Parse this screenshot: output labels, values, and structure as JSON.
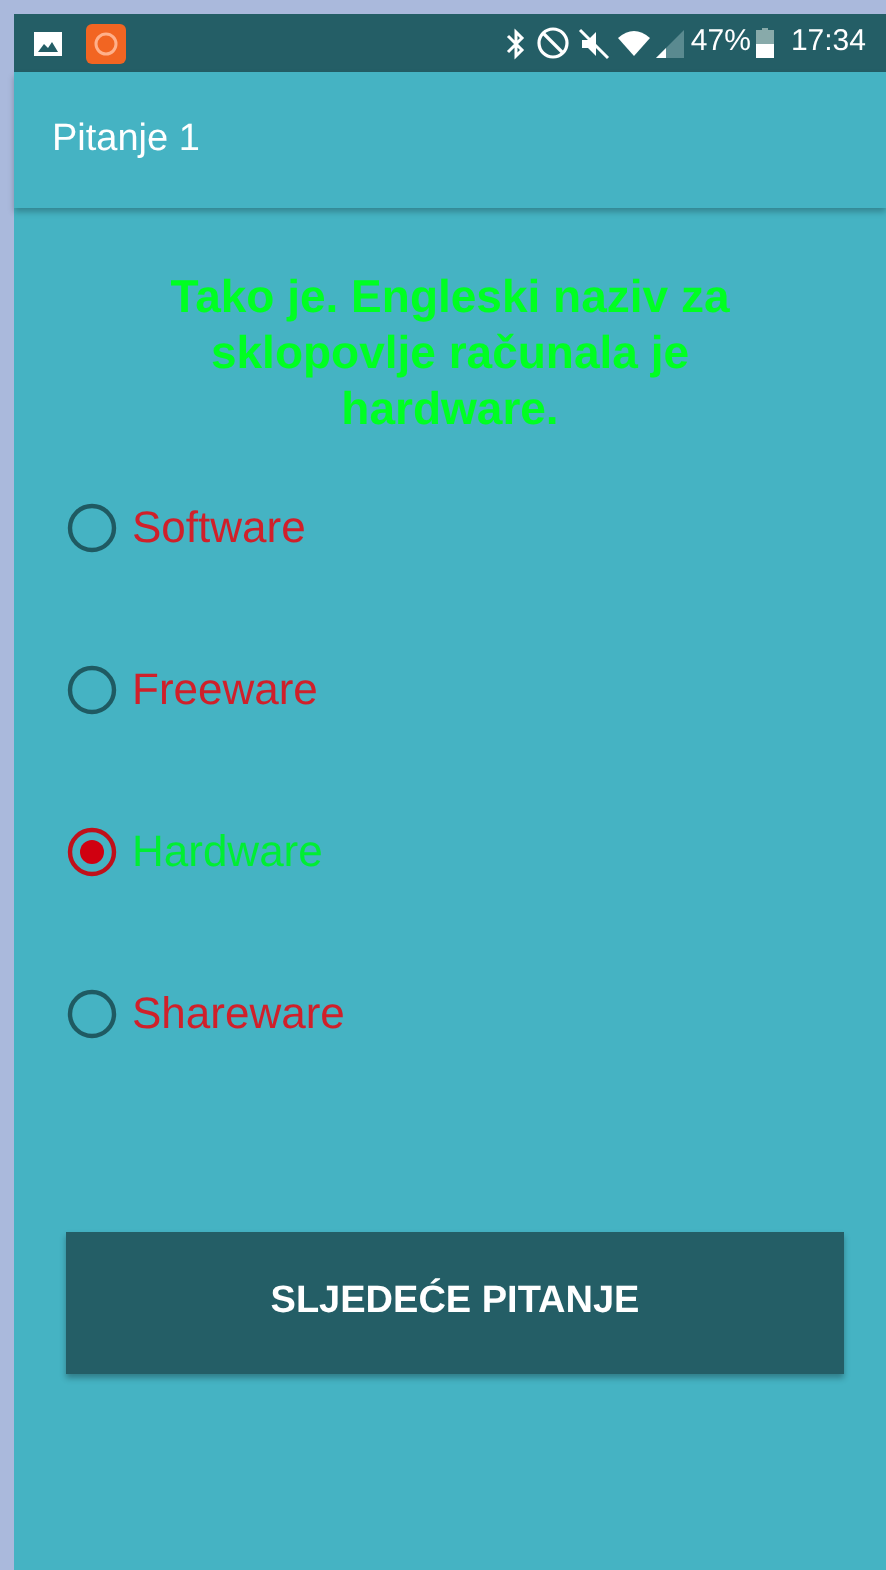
{
  "status_bar": {
    "battery": "47%",
    "time": "17:34"
  },
  "app_bar": {
    "title": "Pitanje 1"
  },
  "feedback": "Tako je. Engleski naziv za sklopovlje računala je hardware.",
  "options": [
    {
      "label": "Software",
      "selected": false,
      "color": "#d0202a"
    },
    {
      "label": "Freeware",
      "selected": false,
      "color": "#d0202a"
    },
    {
      "label": "Hardware",
      "selected": true,
      "color": "#00ee33"
    },
    {
      "label": "Shareware",
      "selected": false,
      "color": "#d0202a"
    }
  ],
  "next_button": "SLJEDEĆE PITANJE"
}
